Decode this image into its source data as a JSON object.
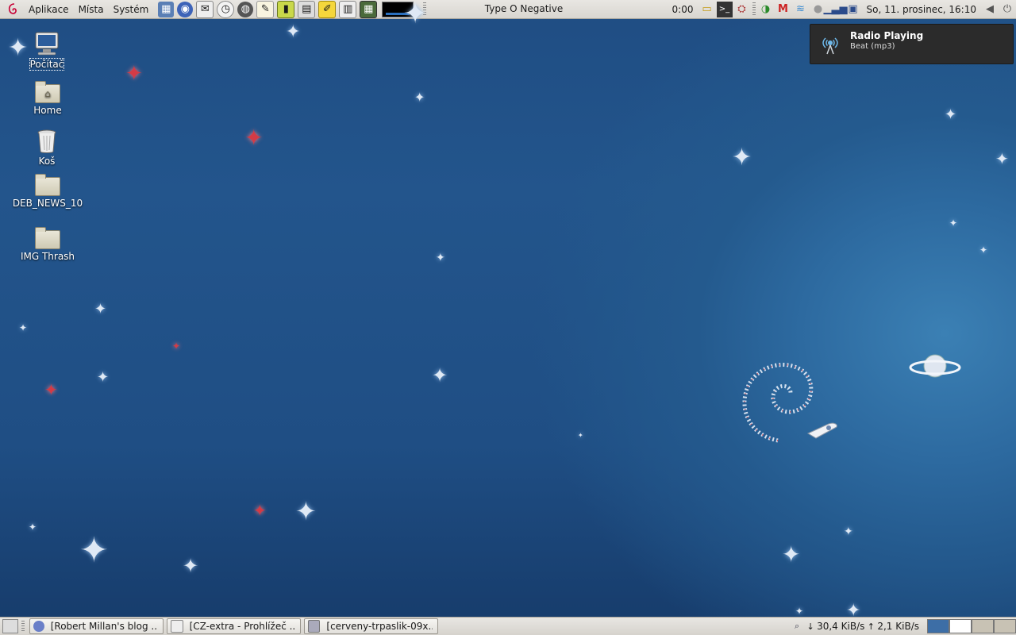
{
  "top_panel": {
    "menus": [
      "Aplikace",
      "Místa",
      "Systém"
    ],
    "launchers": [
      "network-icon",
      "browser-icon",
      "mail-icon",
      "timer-icon",
      "terminal-globe-icon",
      "text-editor-icon",
      "battery-icon",
      "scanner-icon",
      "notes-icon",
      "presentation-icon",
      "calculator-icon"
    ],
    "window_title": "Type O Negative",
    "player_time": "0:00",
    "clock": "So, 11. prosinec, 16:10"
  },
  "desktop": {
    "icons": [
      {
        "label": "Počítač",
        "icon": "computer-icon"
      },
      {
        "label": "Home",
        "icon": "home-folder-icon"
      },
      {
        "label": "Koš",
        "icon": "trash-icon"
      },
      {
        "label": "DEB_NEWS_10",
        "icon": "folder-icon"
      },
      {
        "label": "IMG Thrash",
        "icon": "folder-icon"
      }
    ]
  },
  "notification": {
    "title": "Radio Playing",
    "body": "Beat (mp3)",
    "icon": "radio-antenna-icon"
  },
  "bottom_panel": {
    "tasks": [
      {
        "label": "[Robert Millan's blog ...",
        "icon": "browser-icon"
      },
      {
        "label": "[CZ-extra - Prohlížeč ...",
        "icon": "document-viewer-icon"
      },
      {
        "label": "[cerveny-trpaslik-09x...",
        "icon": "image-viewer-icon"
      }
    ],
    "download_speed": "30,4 KiB/s",
    "upload_speed": "2,1 KiB/s"
  },
  "colors": {
    "panel": "#dcd9d3",
    "desktop_blue": "#245a8e",
    "star_red": "#d43b46",
    "notification_bg": "#2b2b2b"
  }
}
